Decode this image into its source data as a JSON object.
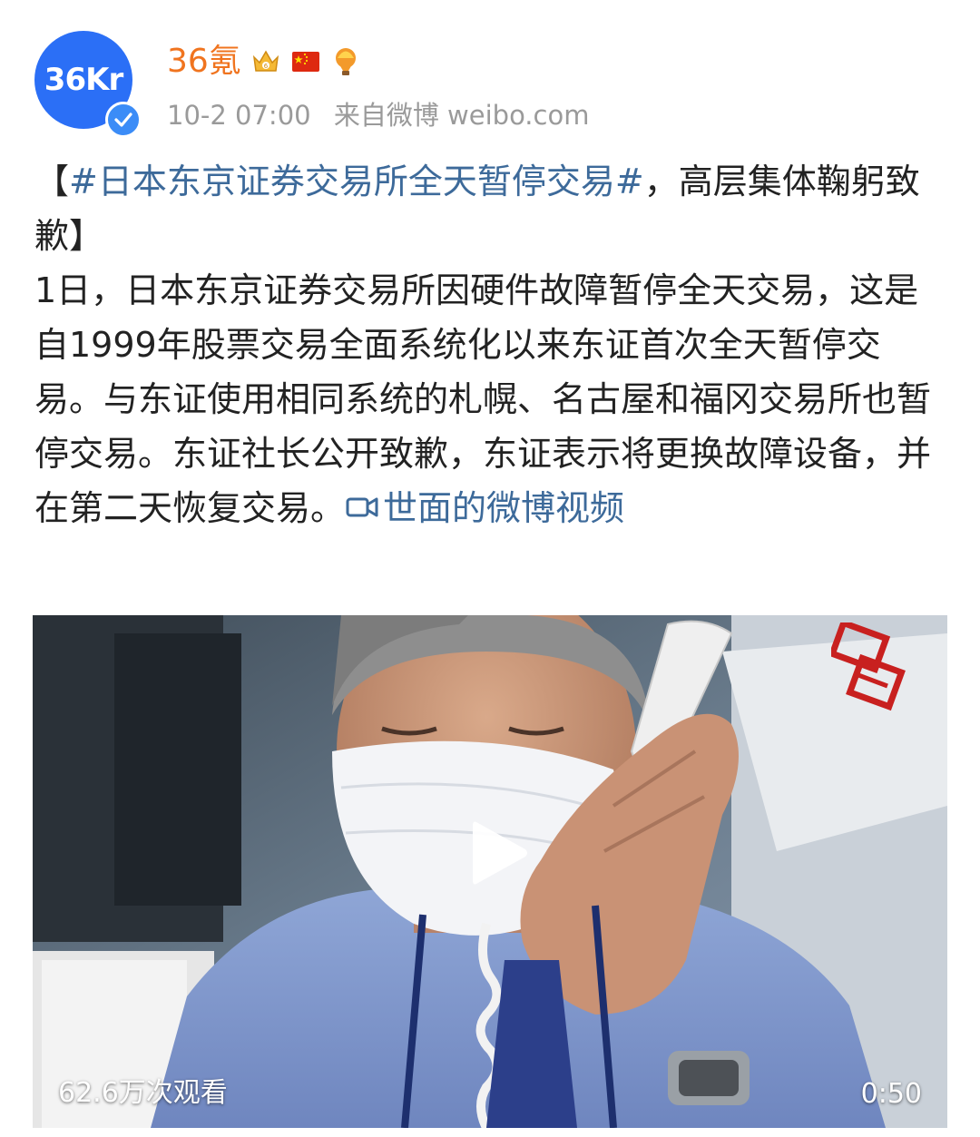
{
  "post": {
    "author": {
      "name": "36氪",
      "avatar_text": "36Kr",
      "verified": true
    },
    "badges": [
      "crown-badge-icon",
      "china-flag-icon",
      "balloon-icon"
    ],
    "meta": {
      "time": "10-2 07:00",
      "source": "来自微博 weibo.com"
    },
    "headline": {
      "open": "【",
      "hashtag": "#日本东京证券交易所全天暂停交易#",
      "rest": "，高层集体鞠躬致歉】"
    },
    "body": "1日，日本东京证券交易所因硬件故障暂停全天交易，这是自1999年股票交易全面系统化以来东证首次全天暂停交易。与东证使用相同系统的札幌、名古屋和福冈交易所也暂停交易。东证社长公开致歉，东证表示将更换故障设备，并在第二天恢复交易。",
    "video_link": "世面的微博视频",
    "video": {
      "views": "62.6万次观看",
      "duration": "0:50"
    },
    "colors": {
      "username": "#f0741f",
      "link": "#3d6a9a",
      "avatar_bg": "#2b6ff6",
      "verified_bg": "#3b8cf7"
    }
  }
}
